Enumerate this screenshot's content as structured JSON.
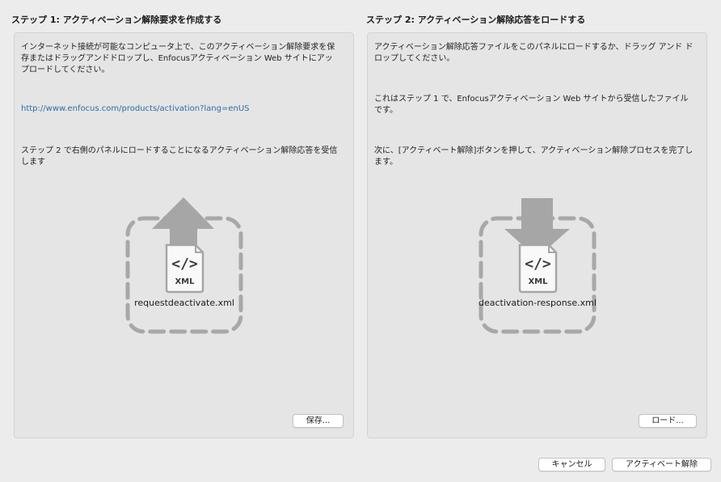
{
  "step1": {
    "title": "ステップ 1: アクティベーション解除要求を作成する",
    "para1": "インターネット接続が可能なコンピュータ上で、このアクティベーション解除要求を保\n存またはドラッグアンドドロップし、Enfocusアクティベーション Web サイトにアッ\nプロードしてください。",
    "link": "http://www.enfocus.com/products/activation?lang=enUS",
    "para2": "ステップ 2 で右側のパネルにロードすることになるアクティベーション解除応答を受信\nします",
    "file_icon_label": "XML",
    "file_icon_code": "</>",
    "file_name": "requestdeactivate.xml",
    "save_label": "保存..."
  },
  "step2": {
    "title": "ステップ 2: アクティベーション解除応答をロードする",
    "para1": "アクティベーション解除応答ファイルをこのパネルにロードするか、ドラッグ アンド ド\nロップしてください。",
    "para2": "これはステップ 1 で、Enfocusアクティベーション Web サイトから受信したファイル\nです。",
    "para3": "次に、[アクティベート解除]ボタンを押して、アクティベーション解除プロセスを完了し\nます。",
    "file_icon_label": "XML",
    "file_icon_code": "</>",
    "file_name": "deactivation-response.xml",
    "load_label": "ロード..."
  },
  "footer": {
    "cancel_label": "キャンセル",
    "deactivate_label": "アクティベート解除"
  },
  "colors": {
    "link": "#2b6ea6",
    "icon_gray": "#a6a6a6",
    "dash_gray": "#a8a8a8"
  }
}
